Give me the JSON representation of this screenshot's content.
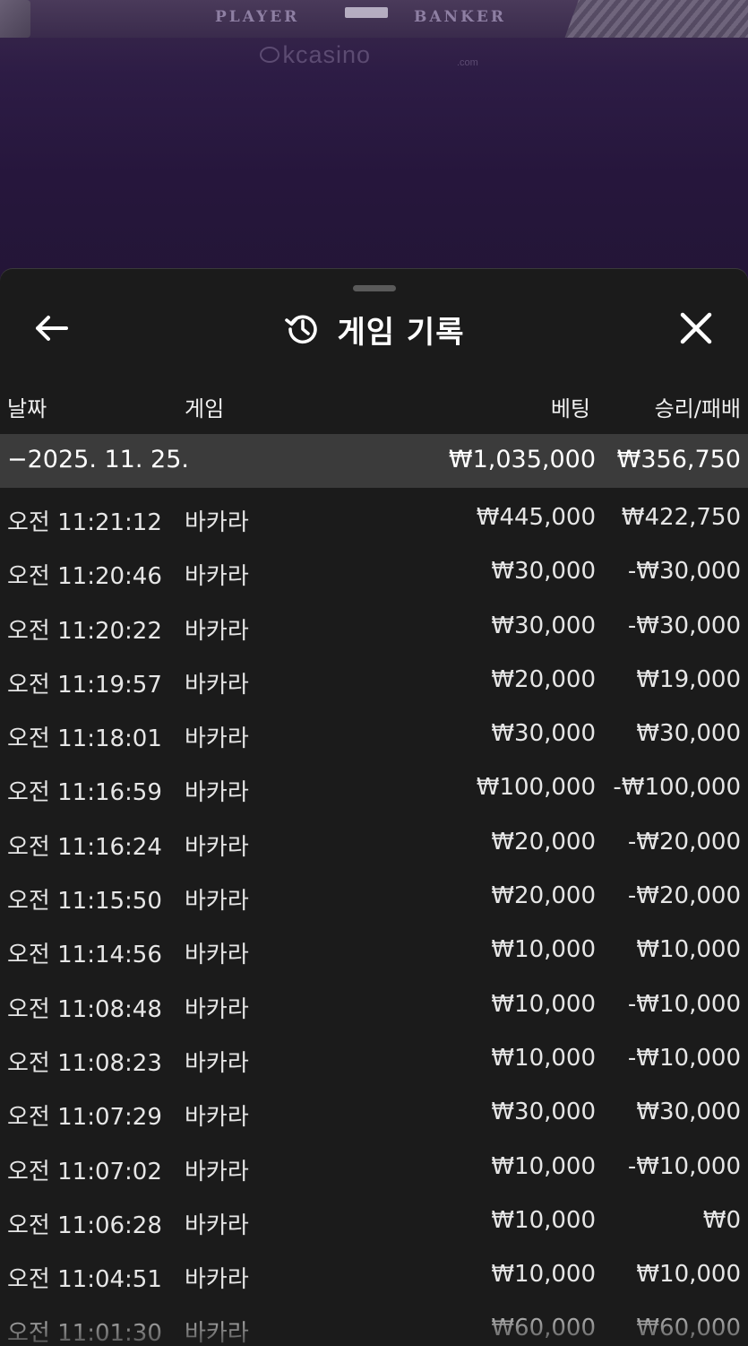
{
  "background": {
    "player_label": "PLAYER",
    "banker_label": "BANKER",
    "watermark": "kcasino",
    "watermark_sub": ".com"
  },
  "sheet": {
    "title": "게임 기록",
    "icons": {
      "back": "arrow-left-icon",
      "title": "history-icon",
      "close": "close-icon"
    }
  },
  "table": {
    "headers": {
      "date": "날짜",
      "game": "게임",
      "bet": "베팅",
      "win_loss": "승리/패배"
    },
    "summary": {
      "date": "−2025. 11. 25.",
      "bet": "₩1,035,000",
      "win_loss": "₩356,750"
    },
    "rows": [
      {
        "time": "오전 11:21:12",
        "game": "바카라",
        "bet": "₩445,000",
        "win_loss": "₩422,750"
      },
      {
        "time": "오전 11:20:46",
        "game": "바카라",
        "bet": "₩30,000",
        "win_loss": "-₩30,000"
      },
      {
        "time": "오전 11:20:22",
        "game": "바카라",
        "bet": "₩30,000",
        "win_loss": "-₩30,000"
      },
      {
        "time": "오전 11:19:57",
        "game": "바카라",
        "bet": "₩20,000",
        "win_loss": "₩19,000"
      },
      {
        "time": "오전 11:18:01",
        "game": "바카라",
        "bet": "₩30,000",
        "win_loss": "₩30,000"
      },
      {
        "time": "오전 11:16:59",
        "game": "바카라",
        "bet": "₩100,000",
        "win_loss": "-₩100,000"
      },
      {
        "time": "오전 11:16:24",
        "game": "바카라",
        "bet": "₩20,000",
        "win_loss": "-₩20,000"
      },
      {
        "time": "오전 11:15:50",
        "game": "바카라",
        "bet": "₩20,000",
        "win_loss": "-₩20,000"
      },
      {
        "time": "오전 11:14:56",
        "game": "바카라",
        "bet": "₩10,000",
        "win_loss": "₩10,000"
      },
      {
        "time": "오전 11:08:48",
        "game": "바카라",
        "bet": "₩10,000",
        "win_loss": "-₩10,000"
      },
      {
        "time": "오전 11:08:23",
        "game": "바카라",
        "bet": "₩10,000",
        "win_loss": "-₩10,000"
      },
      {
        "time": "오전 11:07:29",
        "game": "바카라",
        "bet": "₩30,000",
        "win_loss": "₩30,000"
      },
      {
        "time": "오전 11:07:02",
        "game": "바카라",
        "bet": "₩10,000",
        "win_loss": "-₩10,000"
      },
      {
        "time": "오전 11:06:28",
        "game": "바카라",
        "bet": "₩10,000",
        "win_loss": "₩0"
      },
      {
        "time": "오전 11:04:51",
        "game": "바카라",
        "bet": "₩10,000",
        "win_loss": "₩10,000"
      },
      {
        "time": "오전 11:01:30",
        "game": "바카라",
        "bet": "₩60,000",
        "win_loss": "₩60,000"
      }
    ]
  }
}
